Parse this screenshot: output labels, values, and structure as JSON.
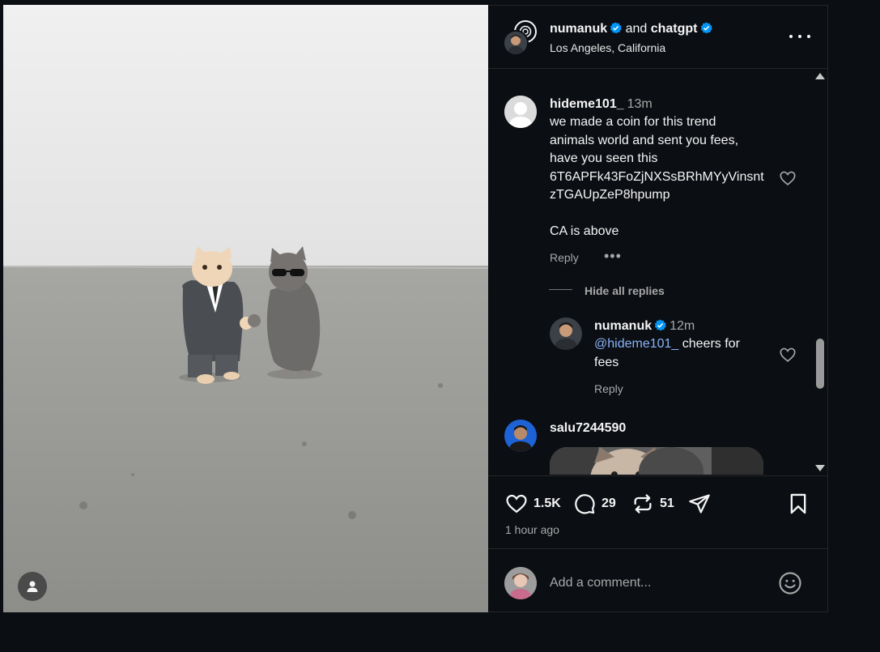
{
  "post": {
    "author1": "numanuk",
    "conjunction": "and",
    "author2": "chatgpt",
    "location": "Los Angeles, California",
    "time_ago": "1 hour ago"
  },
  "comments": [
    {
      "username": "hideme101_",
      "time": "13m",
      "text": "we made a coin for this trend\nanimals world and sent you fees,\nhave you seen this\n6T6APFk43FoZjNXSsBRhMYyVinsnt\nzTGAUpZeP8hpump\n\nCA is above",
      "reply_label": "Reply",
      "more": "•••"
    }
  ],
  "replies_toggle": "Hide all replies",
  "reply": {
    "username": "numanuk",
    "time": "12m",
    "mention": "@hideme101_",
    "text_line1": " cheers for",
    "text_line2": "fees",
    "reply_label": "Reply"
  },
  "comment2": {
    "username": "salu7244590"
  },
  "actions": {
    "likes": "1.5K",
    "comments": "29",
    "reposts": "51"
  },
  "add_comment": {
    "placeholder": "Add a comment..."
  },
  "colors": {
    "verified": "#0095f6",
    "background": "#0b0e13",
    "muted": "#a8a8a8"
  }
}
